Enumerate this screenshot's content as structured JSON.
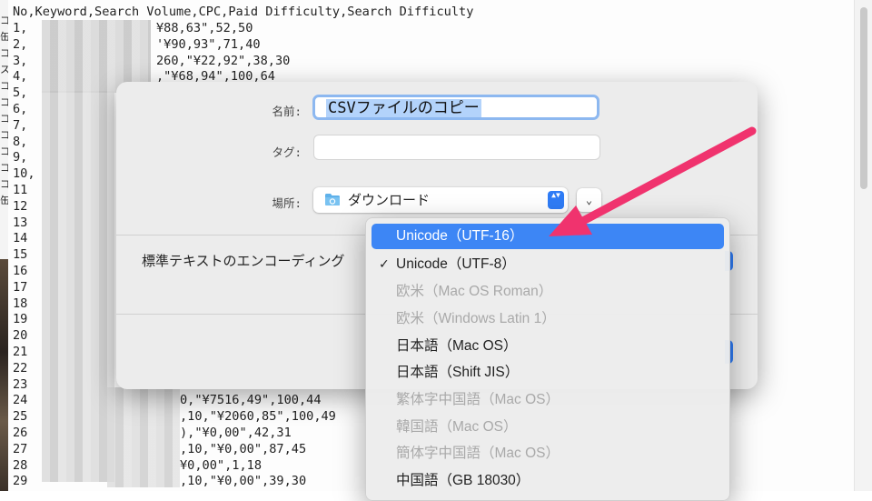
{
  "editor": {
    "header": "No,Keyword,Search Volume,CPC,Paid Difficulty,Search Difficulty",
    "line_numbers": [
      "1,",
      "2,",
      "3,",
      "4,",
      "5,",
      "6,",
      "7,",
      "8,",
      "9,",
      "10,",
      "11",
      "12",
      "13",
      "14",
      "15",
      "16",
      "17",
      "18",
      "19",
      "20",
      "21",
      "22",
      "23",
      "24",
      "25",
      "26",
      "27",
      "28",
      "29"
    ],
    "row_tails": [
      {
        "row": 1,
        "text": "¥88,63\",52,50"
      },
      {
        "row": 2,
        "text": "'¥90,93\",71,40"
      },
      {
        "row": 3,
        "text": "260,\"¥22,92\",38,30"
      },
      {
        "row": 4,
        "text": ",\"¥68,94\",100,64"
      },
      {
        "row": 24,
        "text": "0,\"¥7516,49\",100,44"
      },
      {
        "row": 25,
        "text": ",10,\"¥2060,85\",100,49"
      },
      {
        "row": 26,
        "text": "),\"¥0,00\",42,31"
      },
      {
        "row": 27,
        "text": ",10,\"¥0,00\",87,45"
      },
      {
        "row": 28,
        "text": "¥0,00\",1,18"
      },
      {
        "row": 29,
        "text": ",10,\"¥0,00\",39,30"
      }
    ],
    "left_chars": [
      "コ",
      "缶",
      "コ",
      "ス",
      "コ",
      "コ",
      "コ",
      "コ",
      "コ",
      "コ",
      "コ",
      "缶"
    ]
  },
  "dialog": {
    "name_label": "名前:",
    "name_value": "CSVファイルのコピー",
    "tag_label": "タグ:",
    "tag_value": "",
    "location_label": "場所:",
    "location_value": "ダウンロード",
    "stepper_glyph": "▲▼",
    "expand_glyph": "⌄",
    "encoding_label": "標準テキストのエンコーディング"
  },
  "encoding_menu": {
    "items": [
      {
        "label": "Unicode（UTF-16）",
        "state": "highlighted",
        "checked": false
      },
      {
        "label": "Unicode（UTF-8）",
        "state": "enabled",
        "checked": true
      },
      {
        "label": "欧米（Mac OS Roman）",
        "state": "disabled",
        "checked": false
      },
      {
        "label": "欧米（Windows Latin 1）",
        "state": "disabled",
        "checked": false
      },
      {
        "label": "日本語（Mac OS）",
        "state": "enabled",
        "checked": false
      },
      {
        "label": "日本語（Shift JIS）",
        "state": "enabled",
        "checked": false
      },
      {
        "label": "繁体字中国語（Mac OS）",
        "state": "disabled",
        "checked": false
      },
      {
        "label": "韓国語（Mac OS）",
        "state": "disabled",
        "checked": false
      },
      {
        "label": "簡体字中国語（Mac OS）",
        "state": "disabled",
        "checked": false
      },
      {
        "label": "中国語（GB 18030）",
        "state": "enabled",
        "checked": false
      }
    ],
    "checkmark": "✓"
  },
  "colors": {
    "accent": "#3d86f5",
    "annotation_arrow": "#f0336e"
  },
  "icons": {
    "location": "folder-icon",
    "annotation": "arrow-annotation"
  }
}
